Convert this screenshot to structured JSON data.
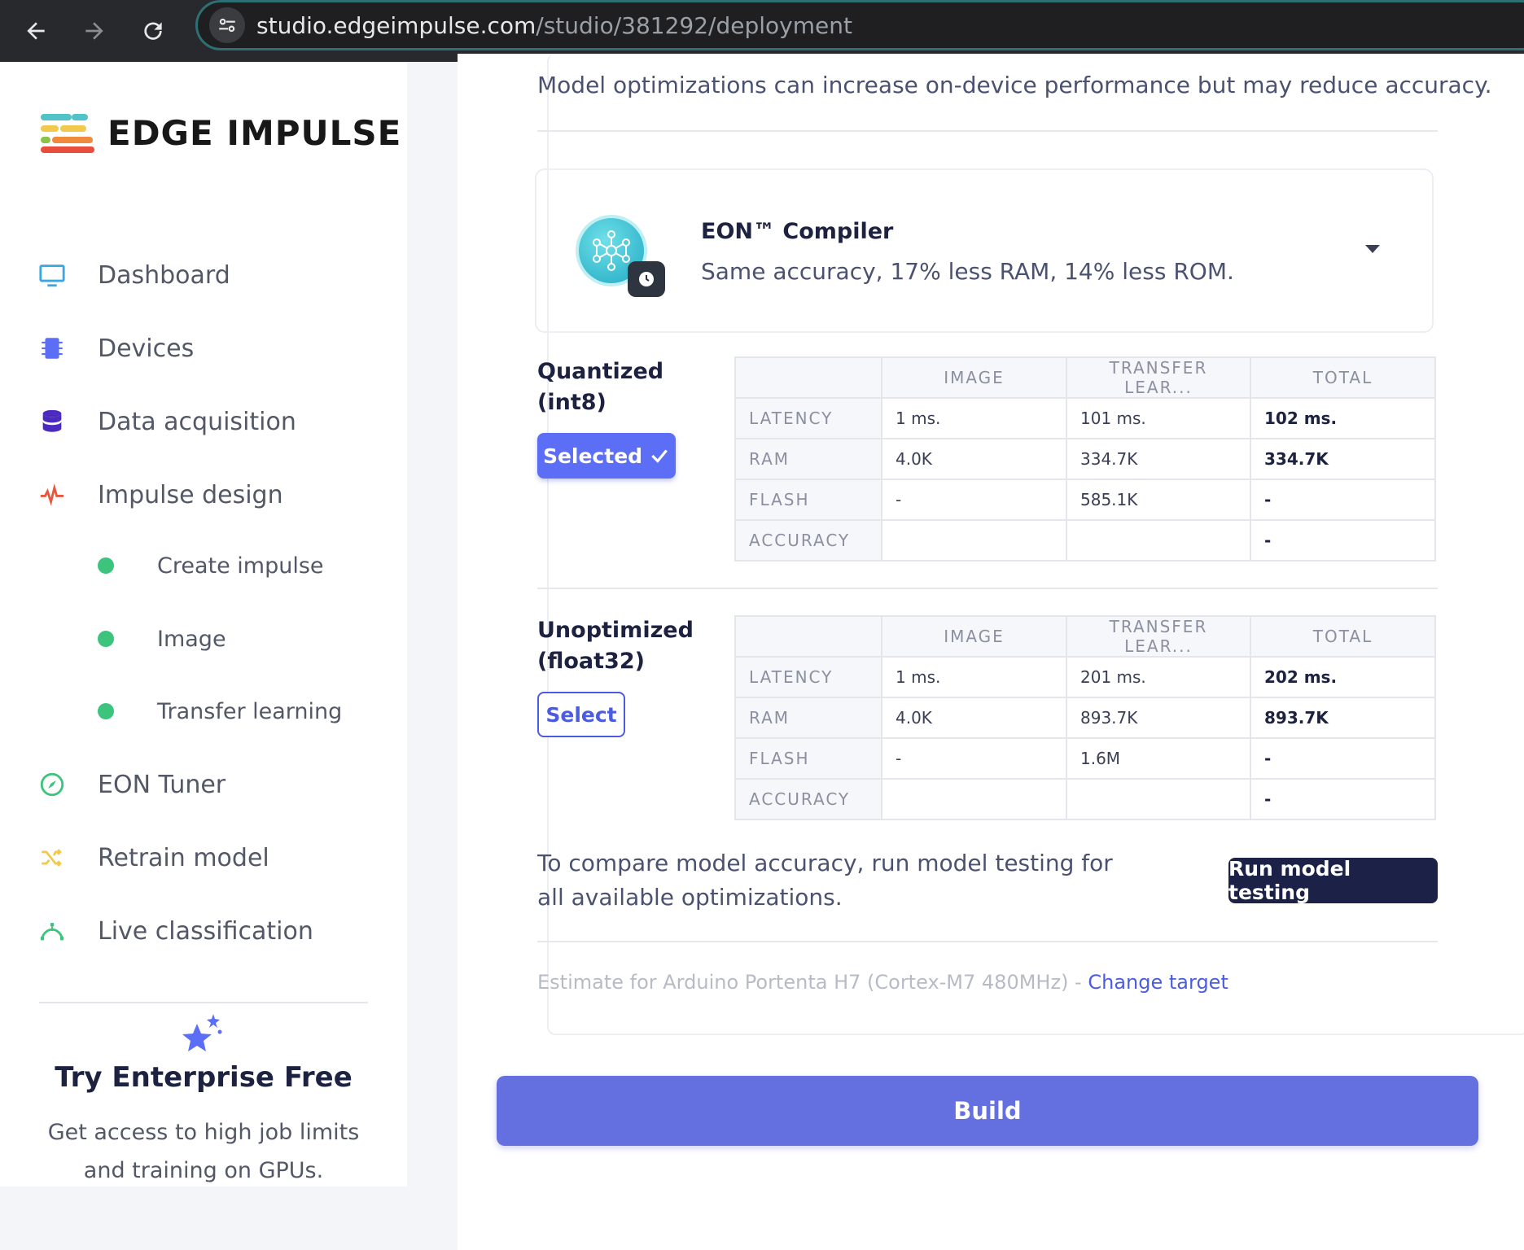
{
  "browser": {
    "url_host": "studio.edgeimpulse.com",
    "url_path": "/studio/381292/deployment",
    "icons": [
      "back-arrow-icon",
      "forward-arrow-icon",
      "reload-icon",
      "site-info-icon"
    ]
  },
  "sidebar": {
    "logo_text": "EDGE IMPULSE",
    "items": [
      {
        "label": "Dashboard",
        "icon": "monitor-icon"
      },
      {
        "label": "Devices",
        "icon": "chip-icon"
      },
      {
        "label": "Data acquisition",
        "icon": "database-icon"
      },
      {
        "label": "Impulse design",
        "icon": "pulse-icon"
      },
      {
        "label": "EON Tuner",
        "icon": "compass-icon"
      },
      {
        "label": "Retrain model",
        "icon": "shuffle-icon"
      },
      {
        "label": "Live classification",
        "icon": "classification-icon"
      }
    ],
    "sub_items": [
      {
        "label": "Create impulse"
      },
      {
        "label": "Image"
      },
      {
        "label": "Transfer learning"
      }
    ],
    "enterprise": {
      "title": "Try Enterprise Free",
      "text": "Get access to high job limits and training on GPUs."
    }
  },
  "main": {
    "intro": "Model optimizations can increase on-device performance but may reduce accuracy.",
    "eon": {
      "title": "EON™ Compiler",
      "description": "Same accuracy, 17% less RAM, 14% less ROM."
    },
    "columns": [
      "",
      "IMAGE",
      "TRANSFER LEAR...",
      "TOTAL"
    ],
    "quantized": {
      "label_line1": "Quantized",
      "label_line2": "(int8)",
      "button": "Selected",
      "rows": [
        [
          "LATENCY",
          "1 ms.",
          "101 ms.",
          "102 ms."
        ],
        [
          "RAM",
          "4.0K",
          "334.7K",
          "334.7K"
        ],
        [
          "FLASH",
          "-",
          "585.1K",
          "-"
        ],
        [
          "ACCURACY",
          "",
          "",
          "-"
        ]
      ]
    },
    "unoptimized": {
      "label_line1": "Unoptimized",
      "label_line2": "(float32)",
      "button": "Select",
      "rows": [
        [
          "LATENCY",
          "1 ms.",
          "201 ms.",
          "202 ms."
        ],
        [
          "RAM",
          "4.0K",
          "893.7K",
          "893.7K"
        ],
        [
          "FLASH",
          "-",
          "1.6M",
          "-"
        ],
        [
          "ACCURACY",
          "",
          "",
          "-"
        ]
      ]
    },
    "compare_text": "To compare model accuracy, run model testing for all available optimizations.",
    "run_button": "Run model testing",
    "estimate_text": "Estimate for Arduino Portenta H7 (Cortex-M7 480MHz) - ",
    "change_target": "Change target",
    "build_button": "Build"
  }
}
